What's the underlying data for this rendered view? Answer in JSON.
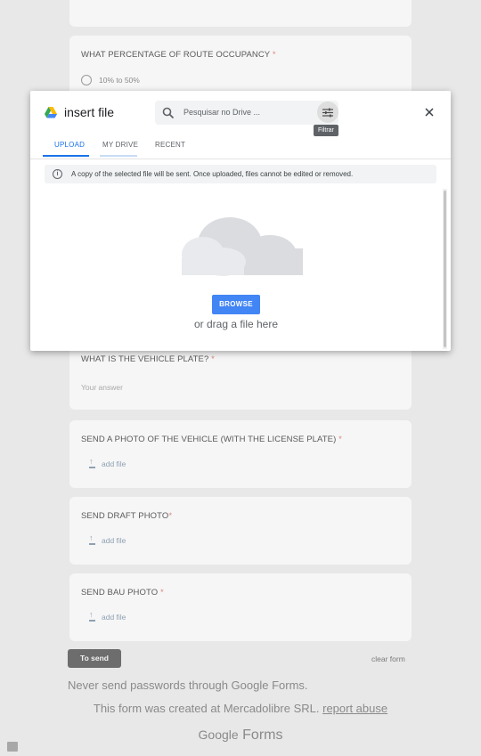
{
  "form": {
    "q_occupancy": {
      "title": "WHAT PERCENTAGE OF ROUTE OCCUPANCY",
      "required_mark": "*",
      "option1": "10% to 50%"
    },
    "q_plate": {
      "title": "WHAT IS THE VEHICLE PLATE?",
      "required_mark": "*",
      "placeholder": "Your answer"
    },
    "q_photo_vehicle": {
      "title": "SEND A PHOTO OF THE VEHICLE (WITH THE LICENSE PLATE)",
      "required_mark": "*",
      "add_label": "add file"
    },
    "q_draft_photo": {
      "title": "SEND DRAFT PHOTO",
      "required_mark": "*",
      "add_label": "add file"
    },
    "q_bau_photo": {
      "title": "SEND BAU PHOTO",
      "required_mark": "*",
      "add_label": "add file"
    },
    "send_label": "To send",
    "clear_label": "clear form"
  },
  "dialog": {
    "title": "insert file",
    "search_placeholder": "Pesquisar no Drive ...",
    "filter_tooltip": "Filtrar",
    "tabs": [
      {
        "label": "UPLOAD"
      },
      {
        "label": "MY DRIVE"
      },
      {
        "label": "RECENT"
      }
    ],
    "info_text": "A copy of the selected file will be sent. Once uploaded, files cannot be edited or removed.",
    "browse_label": "BROWSE",
    "drag_text": "or drag a file here"
  },
  "footer": {
    "warning": "Never send passwords through Google Forms.",
    "created_prefix": "This form was created at Mercadolibre SRL.",
    "report_link": "report abuse",
    "brand_google": "Google",
    "brand_forms": "Forms"
  },
  "colors": {
    "accent": "#1a73e8",
    "browse": "#4285f4",
    "required": "#d9887f"
  }
}
